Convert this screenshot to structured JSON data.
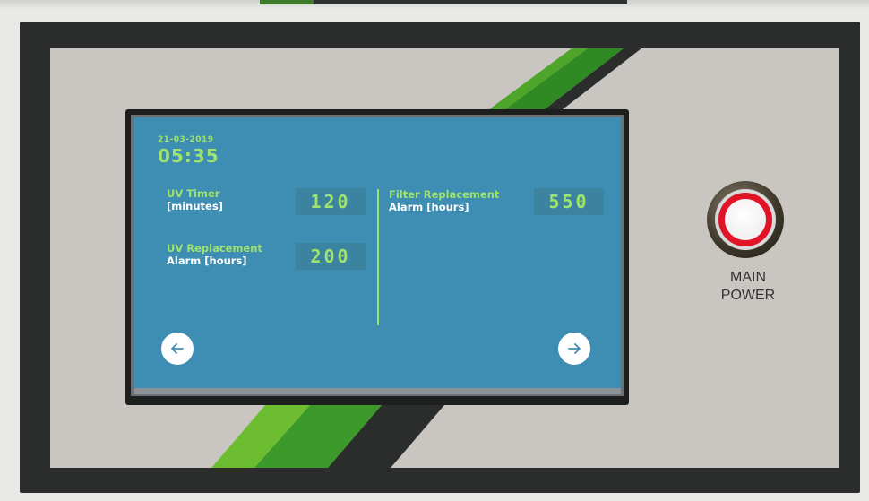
{
  "screen": {
    "date": "21-03-2019",
    "time": "05:35",
    "fields": [
      {
        "label_line1": "UV Timer",
        "label_line2": "[minutes]",
        "value": "120"
      },
      {
        "label_line1": "UV Replacement",
        "label_line2": "Alarm [hours]",
        "value": "200"
      },
      {
        "label_line1": "Filter Replacement",
        "label_line2": "Alarm [hours]",
        "value": "550"
      }
    ],
    "nav": {
      "back_icon": "arrow-left-icon",
      "next_icon": "arrow-right-icon"
    }
  },
  "panel": {
    "main_power_line1": "MAIN",
    "main_power_line2": "POWER"
  },
  "colors": {
    "screen_bg": "#3e8db3",
    "accent_green": "#9de36e",
    "button_red": "#e01426",
    "panel_face": "#c9c6c2",
    "frame": "#2a2d2c"
  }
}
